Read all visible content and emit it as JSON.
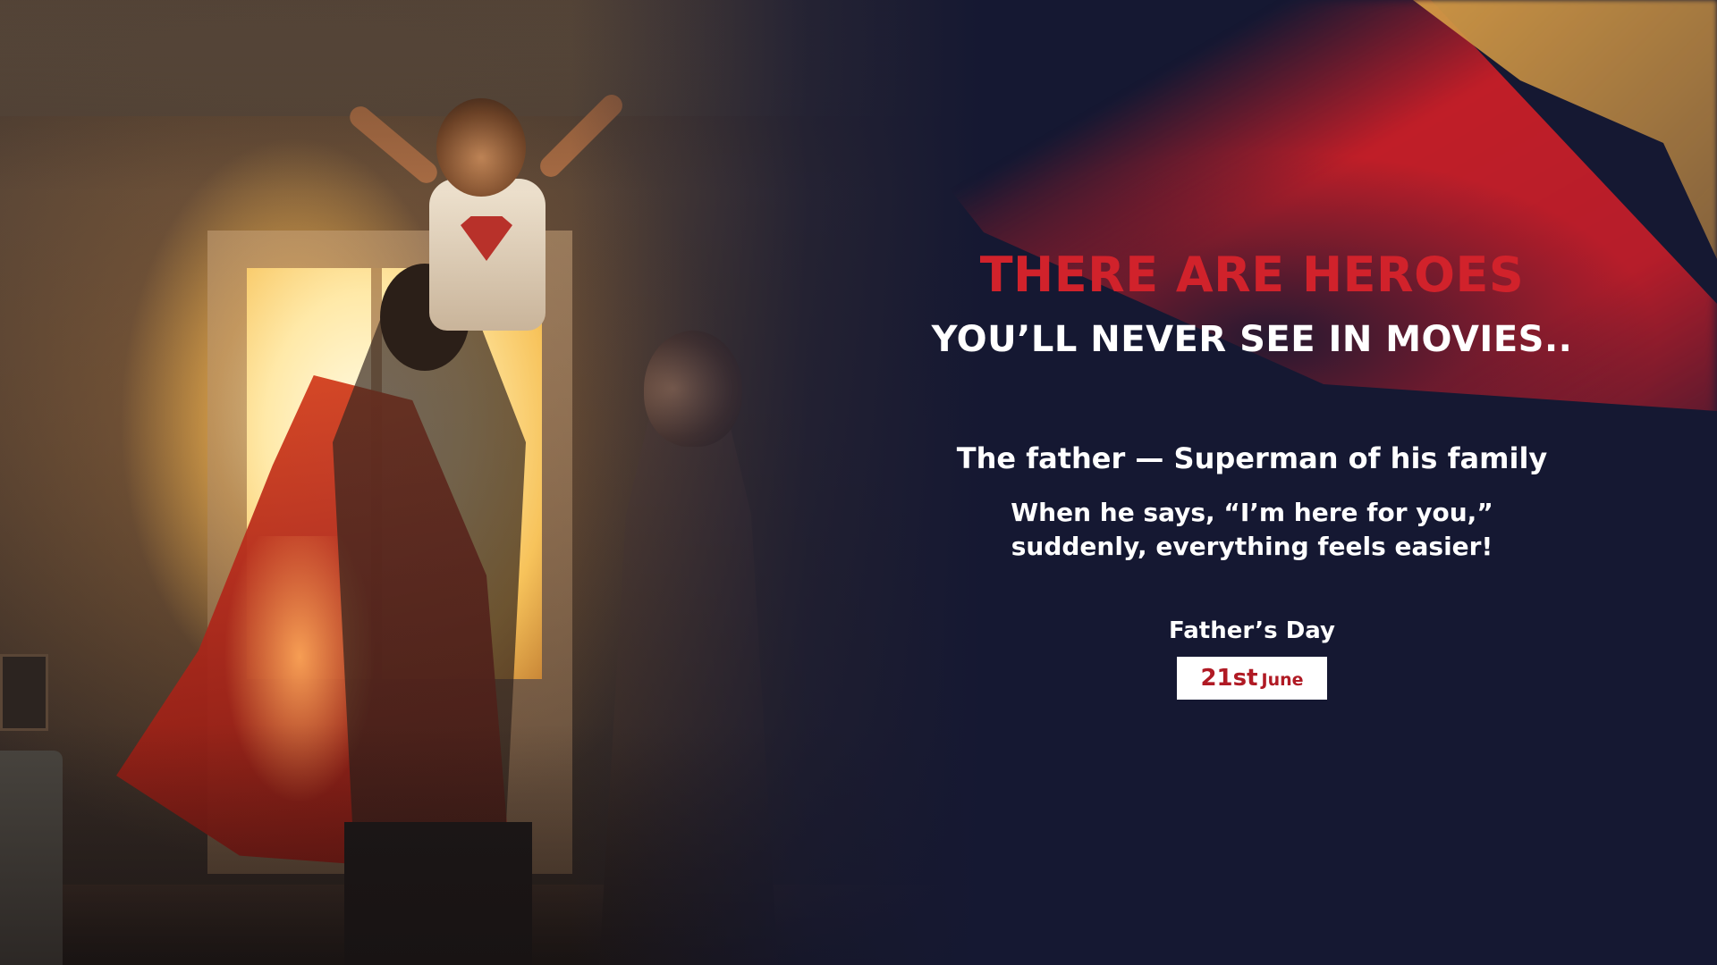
{
  "headline": "THERE ARE HEROES",
  "subheadline": "YOU’LL NEVER SEE IN MOVIES..",
  "tagline": "The father — Superman of his family",
  "quote": {
    "line1": "When he says, “I’m here for you,”",
    "line2": "suddenly, everything feels easier!"
  },
  "occasion": "Father’s Day",
  "date": {
    "day": "21st",
    "month": "June"
  },
  "colors": {
    "headline_red": "#d1222b",
    "background_navy": "#151832",
    "ribbon_red": "#c01e28",
    "ribbon_gold": "#e6a845",
    "badge_text": "#b01a24"
  }
}
